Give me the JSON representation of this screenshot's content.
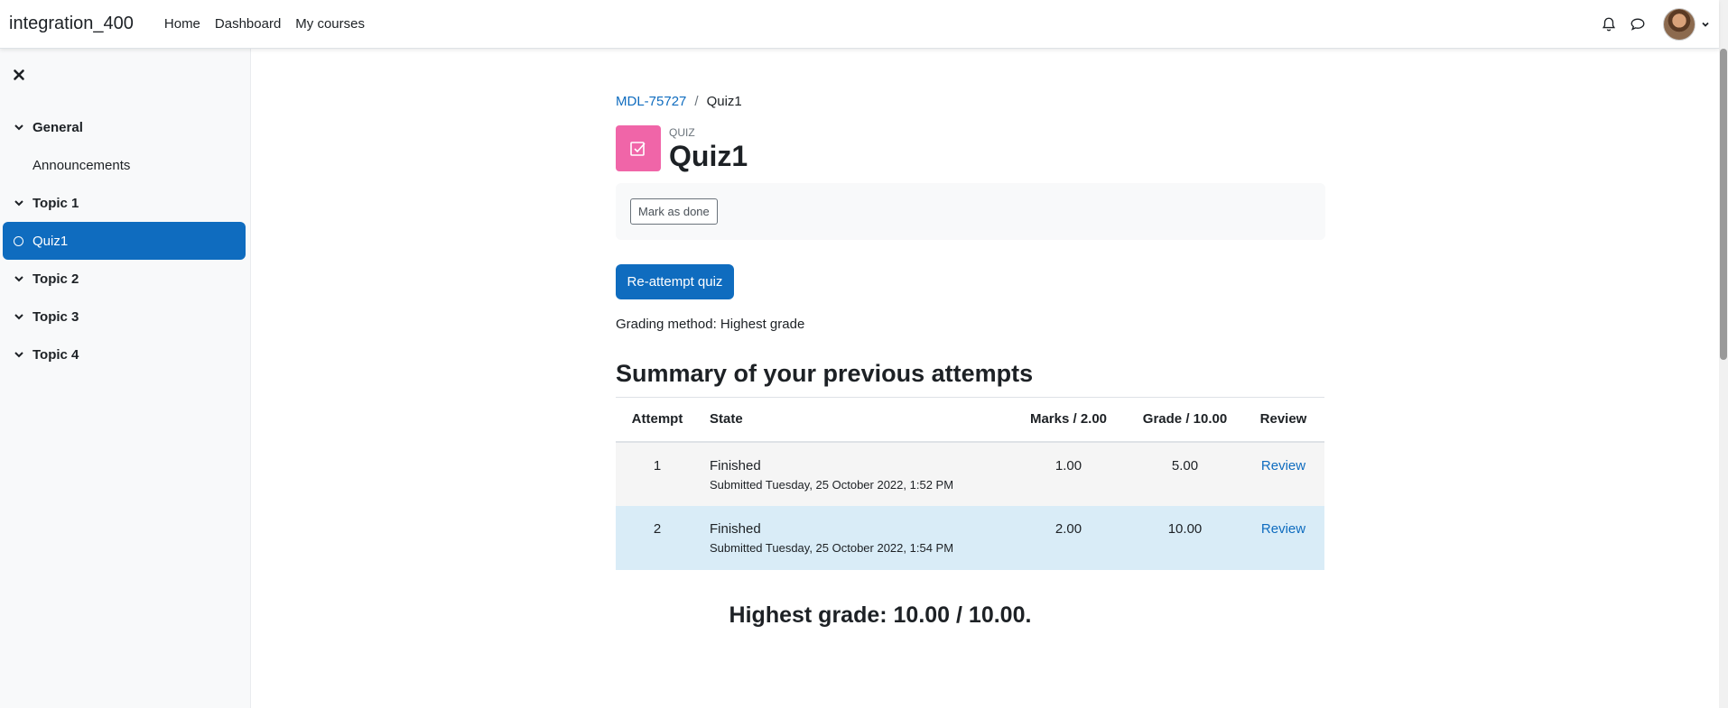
{
  "navbar": {
    "brand": "integration_400",
    "links": [
      "Home",
      "Dashboard",
      "My courses"
    ],
    "icons": [
      "bell-icon",
      "chat-icon"
    ]
  },
  "drawer": {
    "close_icon": "close-icon",
    "items": [
      {
        "label": "General",
        "type": "section"
      },
      {
        "label": "Announcements",
        "type": "activity"
      },
      {
        "label": "Topic 1",
        "type": "section"
      },
      {
        "label": "Quiz1",
        "type": "activity-active"
      },
      {
        "label": "Topic 2",
        "type": "section"
      },
      {
        "label": "Topic 3",
        "type": "section"
      },
      {
        "label": "Topic 4",
        "type": "section"
      }
    ]
  },
  "breadcrumb": {
    "course": "MDL-75727",
    "separator": "/",
    "current": "Quiz1"
  },
  "header": {
    "type_label": "QUIZ",
    "title": "Quiz1",
    "icon_color": "#f065a8"
  },
  "mark_done_label": "Mark as done",
  "reattempt_label": "Re-attempt quiz",
  "grading_method": "Grading method: Highest grade",
  "summary_title": "Summary of your previous attempts",
  "table": {
    "headers": [
      "Attempt",
      "State",
      "Marks / 2.00",
      "Grade / 10.00",
      "Review"
    ],
    "rows": [
      {
        "attempt": "1",
        "state": "Finished",
        "submitted": "Submitted Tuesday, 25 October 2022, 1:52 PM",
        "marks": "1.00",
        "grade": "5.00",
        "review": "Review"
      },
      {
        "attempt": "2",
        "state": "Finished",
        "submitted": "Submitted Tuesday, 25 October 2022, 1:54 PM",
        "marks": "2.00",
        "grade": "10.00",
        "review": "Review"
      }
    ]
  },
  "highest_grade": "Highest grade: 10.00 / 10.00.",
  "colors": {
    "primary": "#0f6cbf",
    "quiz": "#f065a8",
    "highlight_row": "#d9ecf7"
  }
}
